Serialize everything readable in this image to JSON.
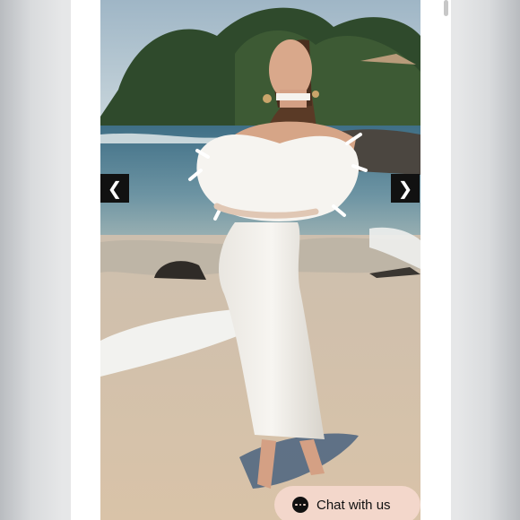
{
  "gallery": {
    "image_alt": "Model in white off-shoulder feather dress on beach",
    "prev_glyph": "❮",
    "next_glyph": "❯"
  },
  "chat": {
    "label": "Chat with us",
    "icon": "chat-bubble-icon"
  },
  "colors": {
    "arrow_background": "#111111",
    "chat_background": "#f3d7cb"
  }
}
